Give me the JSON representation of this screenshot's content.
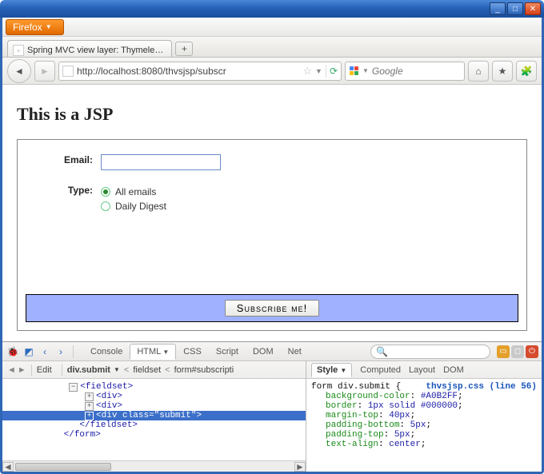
{
  "window": {
    "app_button": "Firefox",
    "tab_title": "Spring MVC view layer: Thymele…",
    "url": "http://localhost:8080/thvsjsp/subscr",
    "search_placeholder": "Google"
  },
  "page": {
    "heading": "This is a JSP",
    "email_label": "Email:",
    "type_label": "Type:",
    "radio_all": "All emails",
    "radio_daily": "Daily Digest",
    "submit_label": "Subscribe me!"
  },
  "devtools": {
    "top_tabs": [
      "Console",
      "HTML",
      "CSS",
      "Script",
      "DOM",
      "Net"
    ],
    "top_active": "HTML",
    "edit_label": "Edit",
    "crumb_selected": "div.submit",
    "crumb_rest": [
      "fieldset",
      "form#subscripti"
    ],
    "src": {
      "l1": "<fieldset>",
      "l2": "<div>",
      "l3": "<div>",
      "l4": "<div class=\"submit\">",
      "l5": "</fieldset>",
      "l6": "</form>"
    },
    "right_tabs": [
      "Style",
      "Computed",
      "Layout",
      "DOM"
    ],
    "right_active": "Style",
    "css": {
      "selector": "form div.submit {",
      "source": "thvsjsp.css (line 56)",
      "d1p": "background-color",
      "d1v": "#A0B2FF",
      "d2p": "border",
      "d2v": "1px solid #000000",
      "d3p": "margin-top",
      "d3v": "40px",
      "d4p": "padding-bottom",
      "d4v": "5px",
      "d5p": "padding-top",
      "d5v": "5px",
      "d6p": "text-align",
      "d6v": "center"
    }
  }
}
